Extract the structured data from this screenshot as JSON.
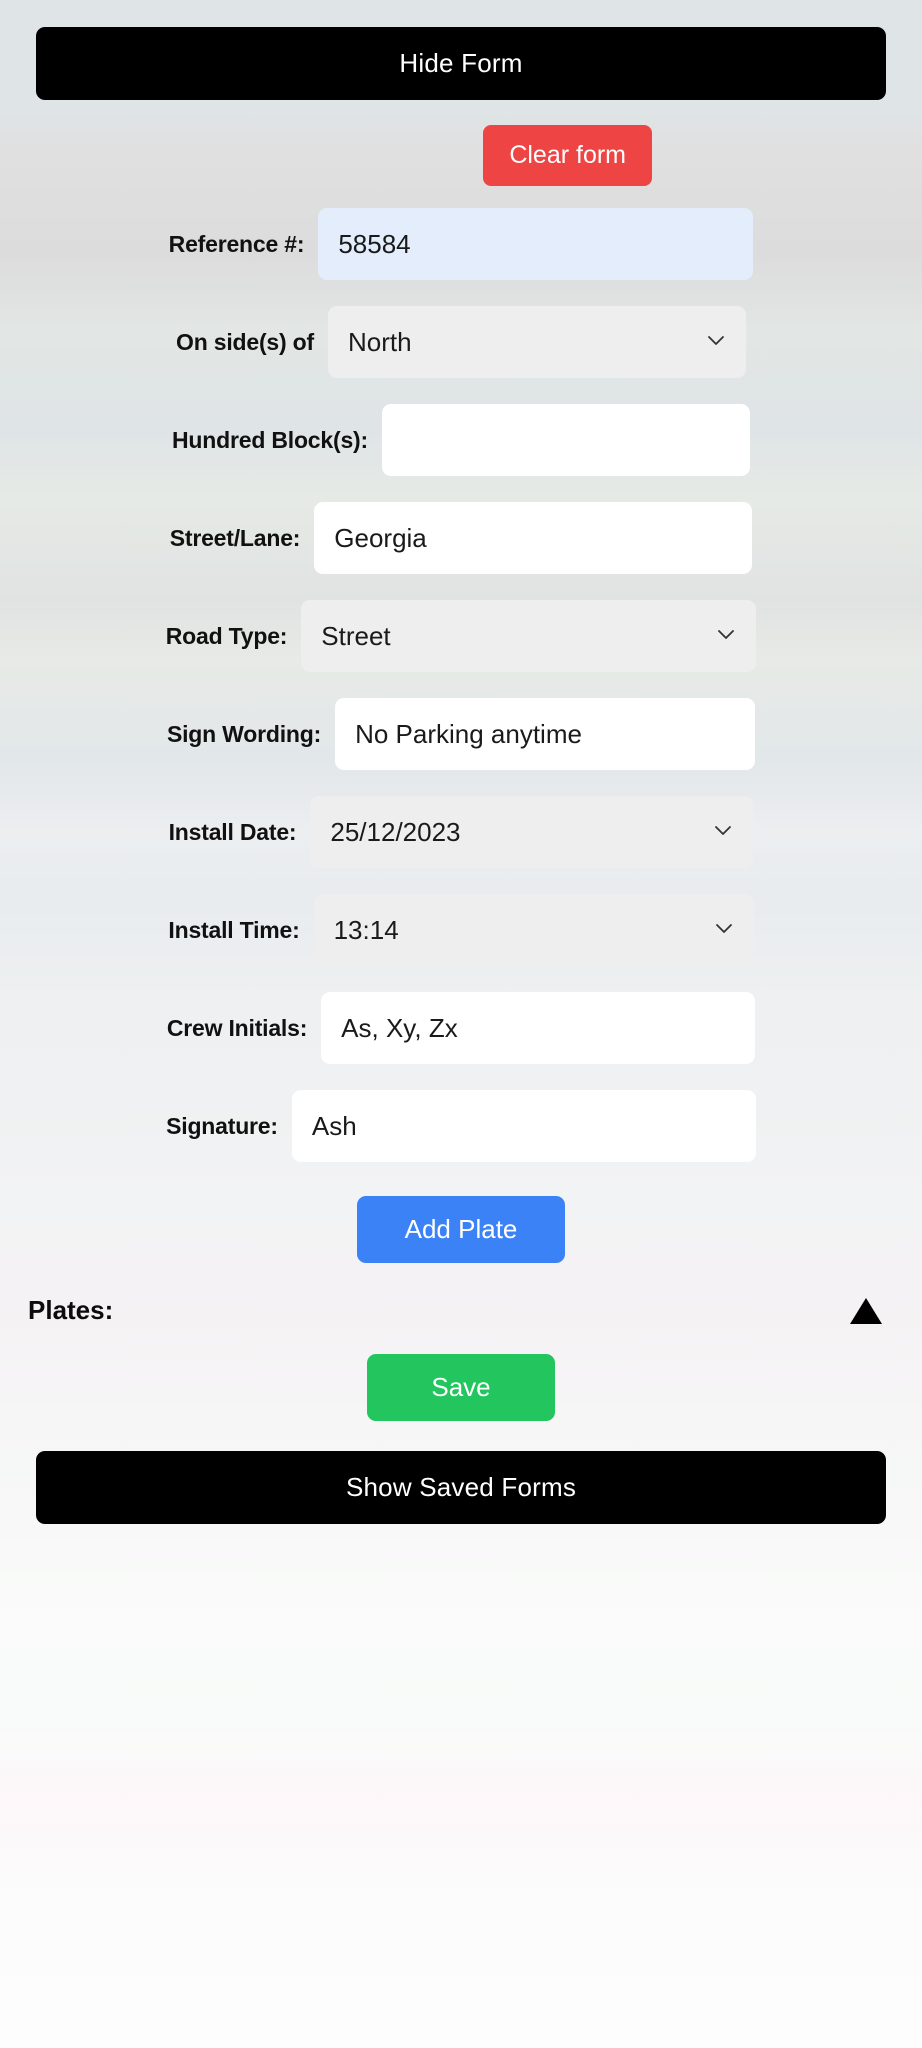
{
  "header": {
    "toggle_form_label": "Hide Form"
  },
  "toolbar": {
    "clear_label": "Clear form"
  },
  "form": {
    "fields": [
      {
        "label": "Reference #:",
        "value": "58584",
        "type": "text",
        "style": "autofill",
        "width": "w-ref"
      },
      {
        "label": "On side(s) of",
        "value": "North",
        "type": "select",
        "style": "select",
        "width": "w-side"
      },
      {
        "label": "Hundred Block(s):",
        "value": "",
        "type": "text",
        "style": "text",
        "width": "w-hundred"
      },
      {
        "label": "Street/Lane:",
        "value": "Georgia",
        "type": "text",
        "style": "text",
        "width": "w-street"
      },
      {
        "label": "Road Type:",
        "value": "Street",
        "type": "select",
        "style": "select",
        "width": "w-road"
      },
      {
        "label": "Sign Wording:",
        "value": "No Parking anytime",
        "type": "text",
        "style": "text",
        "width": "w-sign"
      },
      {
        "label": "Install Date:",
        "value": "25/12/2023",
        "type": "select",
        "style": "select",
        "width": "w-date"
      },
      {
        "label": "Install Time:",
        "value": "13:14",
        "type": "select",
        "style": "select",
        "width": "w-time"
      },
      {
        "label": "Crew Initials:",
        "value": "As, Xy, Zx",
        "type": "text",
        "style": "text",
        "width": "w-crew"
      },
      {
        "label": "Signature:",
        "value": "Ash",
        "type": "text",
        "style": "text",
        "width": "w-sig"
      }
    ]
  },
  "actions": {
    "add_plate_label": "Add Plate",
    "save_label": "Save",
    "show_saved_forms_label": "Show Saved Forms"
  },
  "plates": {
    "label": "Plates:",
    "toggle_icon": "triangle-up-icon"
  },
  "colors": {
    "black_button": "#000000",
    "clear_red": "#ef4444",
    "add_plate_blue": "#3b82f6",
    "save_green": "#22c55e",
    "autofill_blue": "#e4edfb",
    "select_gray": "#eeeeee",
    "input_white": "#ffffff"
  }
}
